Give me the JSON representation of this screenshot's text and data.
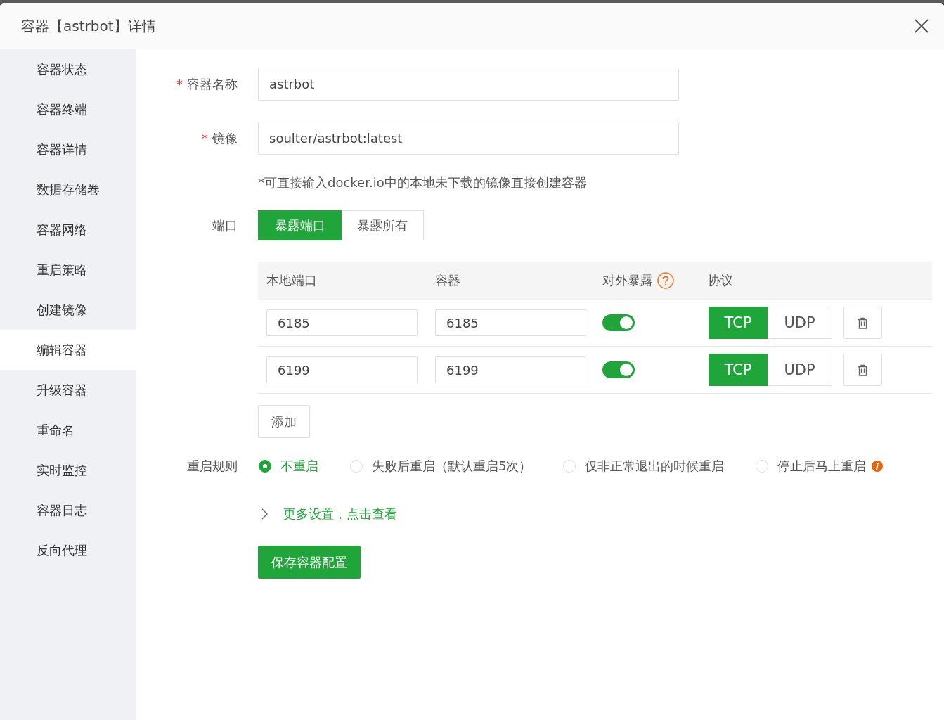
{
  "dialog": {
    "title": "容器【astrbot】详情"
  },
  "sidebar": {
    "items": [
      {
        "label": "容器状态",
        "selected": false
      },
      {
        "label": "容器终端",
        "selected": false
      },
      {
        "label": "容器详情",
        "selected": false
      },
      {
        "label": "数据存储卷",
        "selected": false
      },
      {
        "label": "容器网络",
        "selected": false
      },
      {
        "label": "重启策略",
        "selected": false
      },
      {
        "label": "创建镜像",
        "selected": false
      },
      {
        "label": "编辑容器",
        "selected": true
      },
      {
        "label": "升级容器",
        "selected": false
      },
      {
        "label": "重命名",
        "selected": false
      },
      {
        "label": "实时监控",
        "selected": false
      },
      {
        "label": "容器日志",
        "selected": false
      },
      {
        "label": "反向代理",
        "selected": false
      }
    ]
  },
  "form": {
    "name_field": {
      "required_mark": "*",
      "label": "容器名称",
      "value": "astrbot"
    },
    "image_field": {
      "required_mark": "*",
      "label": "镜像",
      "value": "soulter/astrbot:latest",
      "hint": "*可直接输入docker.io中的本地未下载的镜像直接创建容器"
    },
    "ports": {
      "label": "端口",
      "modes": [
        {
          "label": "暴露端口",
          "selected": true
        },
        {
          "label": "暴露所有",
          "selected": false
        }
      ],
      "table": {
        "columns": [
          {
            "label": "本地端口",
            "help": false
          },
          {
            "label": "容器",
            "help": false
          },
          {
            "label": "对外暴露",
            "help": true
          },
          {
            "label": "协议",
            "help": false
          }
        ],
        "rows": [
          {
            "local_port": "6185",
            "container_port": "6185",
            "exposed": true,
            "protocols": [
              {
                "label": "TCP",
                "selected": true
              },
              {
                "label": "UDP",
                "selected": false
              }
            ]
          },
          {
            "local_port": "6199",
            "container_port": "6199",
            "exposed": true,
            "protocols": [
              {
                "label": "TCP",
                "selected": true
              },
              {
                "label": "UDP",
                "selected": false
              }
            ]
          }
        ]
      },
      "add_button": "添加"
    },
    "restart": {
      "label": "重启规则",
      "options": [
        {
          "label": "不重启",
          "selected": true,
          "info": false
        },
        {
          "label": "失败后重启（默认重启5次）",
          "selected": false,
          "info": false
        },
        {
          "label": "仅非正常退出的时候重启",
          "selected": false,
          "info": false
        },
        {
          "label": "停止后马上重启",
          "selected": false,
          "info": true
        }
      ]
    },
    "more_settings": {
      "label": "更多设置，点击查看",
      "expanded": false
    },
    "save_button": "保存容器配置"
  }
}
